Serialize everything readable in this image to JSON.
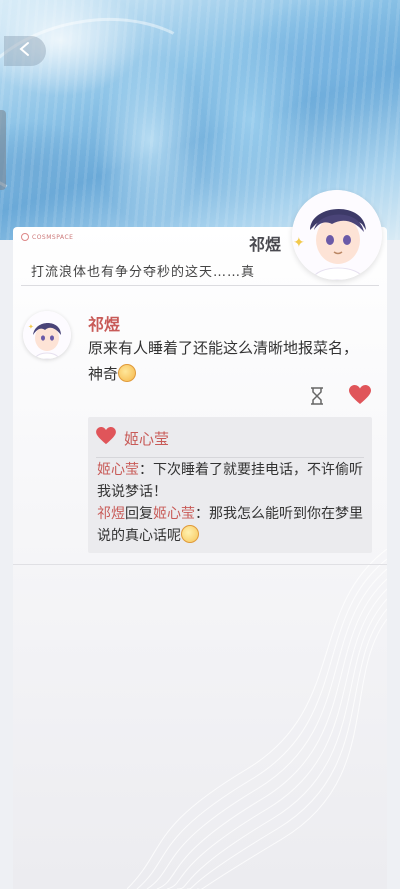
{
  "nav": {
    "back_icon": "chevron-left-icon"
  },
  "post": {
    "logo_text": "COSMSPACE",
    "author": "祁煜",
    "title": "打流浪体也有争分夺秒的这天……真"
  },
  "comment": {
    "name": "祁煜",
    "text_part1": "原来有人睡着了还能这么清晰地报菜名，神奇",
    "emoji": "smiling-face-emoji",
    "liked": true,
    "icons": [
      "hourglass-icon",
      "heart-icon"
    ]
  },
  "reply_box": {
    "header_name": "姬心莹",
    "line1_name": "姬心莹",
    "line1_text": "：下次睡着了就要挂电话，不许偷听我说梦话！",
    "line2_name": "祁煜",
    "line2_mid": "回复",
    "line2_target": "姬心莹",
    "line2_text": "：那我怎么能听到你在梦里说的真心话呢"
  },
  "colors": {
    "accent": "#c85b58",
    "heart": "#e0555a"
  }
}
